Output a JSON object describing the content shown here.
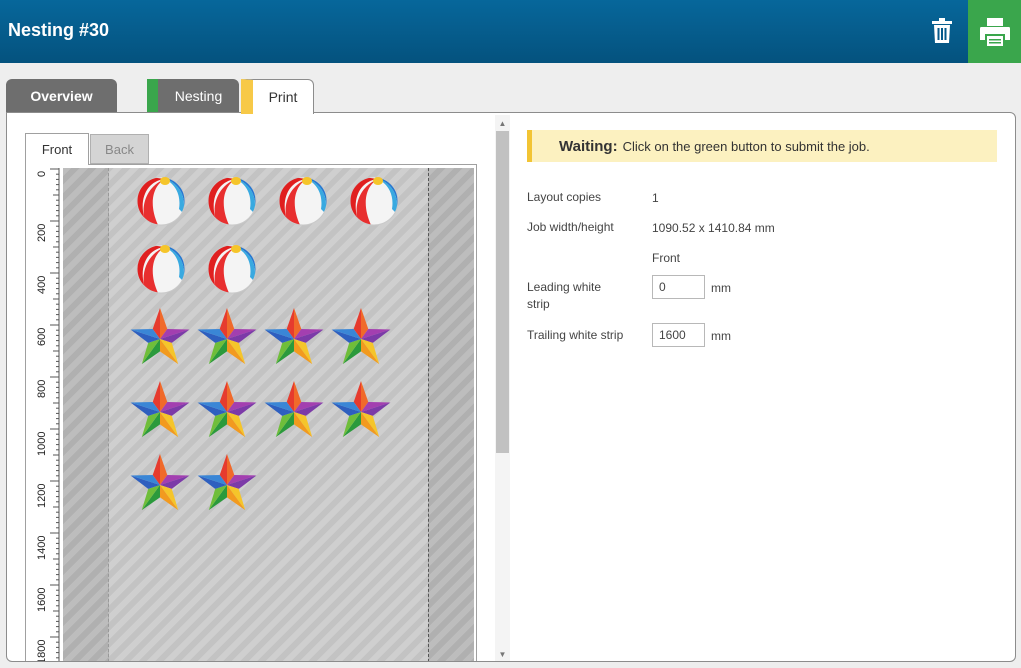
{
  "header": {
    "title": "Nesting #30",
    "delete_icon": "trash-icon",
    "print_icon": "printer-icon",
    "accent": "#3aa64c"
  },
  "tabs": {
    "overview": "Overview",
    "nesting": "Nesting",
    "print": "Print"
  },
  "preview": {
    "sides": {
      "front": "Front",
      "back": "Back"
    },
    "ruler_labels": [
      "0",
      "200",
      "400",
      "600",
      "800",
      "1000",
      "1200",
      "1400",
      "1600",
      "1800"
    ],
    "items": {
      "beach_balls": 6,
      "stars": 10
    }
  },
  "status": {
    "state": "Waiting:",
    "message": "Click on the green button to submit the job."
  },
  "properties": {
    "layout_copies_label": "Layout copies",
    "layout_copies_value": "1",
    "job_size_label": "Job width/height",
    "job_size_value": "1090.52 x 1410.84 mm",
    "side_heading": "Front",
    "leading_label": "Leading white strip",
    "leading_value": "0",
    "trailing_label": "Trailing white strip",
    "trailing_value": "1600",
    "unit": "mm"
  }
}
